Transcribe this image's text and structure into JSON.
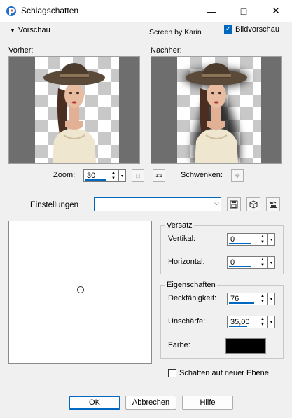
{
  "window": {
    "title": "Schlagschatten",
    "minimize_glyph": "—",
    "maximize_glyph": "□",
    "close_glyph": "✕"
  },
  "preview": {
    "toggle_label": "Vorschau",
    "credit": "Screen by Karin",
    "show_preview_label": "Bildvorschau",
    "show_preview_checked": true,
    "before_label": "Vorher:",
    "after_label": "Nachher:"
  },
  "zoom": {
    "label": "Zoom:",
    "value": "30",
    "pan_label": "Schwenken:"
  },
  "settings": {
    "label": "Einstellungen",
    "value": ""
  },
  "offset": {
    "group_title": "Versatz",
    "vertical_label": "Vertikal:",
    "vertical_value": "0",
    "horizontal_label": "Horizontal:",
    "horizontal_value": "0"
  },
  "properties": {
    "group_title": "Eigenschaften",
    "opacity_label": "Deckfähigkeit:",
    "opacity_value": "76",
    "blur_label": "Unschärfe:",
    "blur_value": "35,00",
    "color_label": "Farbe:",
    "shadow_color": "#000000"
  },
  "options": {
    "new_layer_label": "Schatten auf neuer Ebene",
    "new_layer_checked": false
  },
  "buttons": {
    "ok": "OK",
    "cancel": "Abbrechen",
    "help": "Hilfe"
  },
  "colors": {
    "accent": "#0067c0",
    "pane_background": "#6e6e6e"
  }
}
